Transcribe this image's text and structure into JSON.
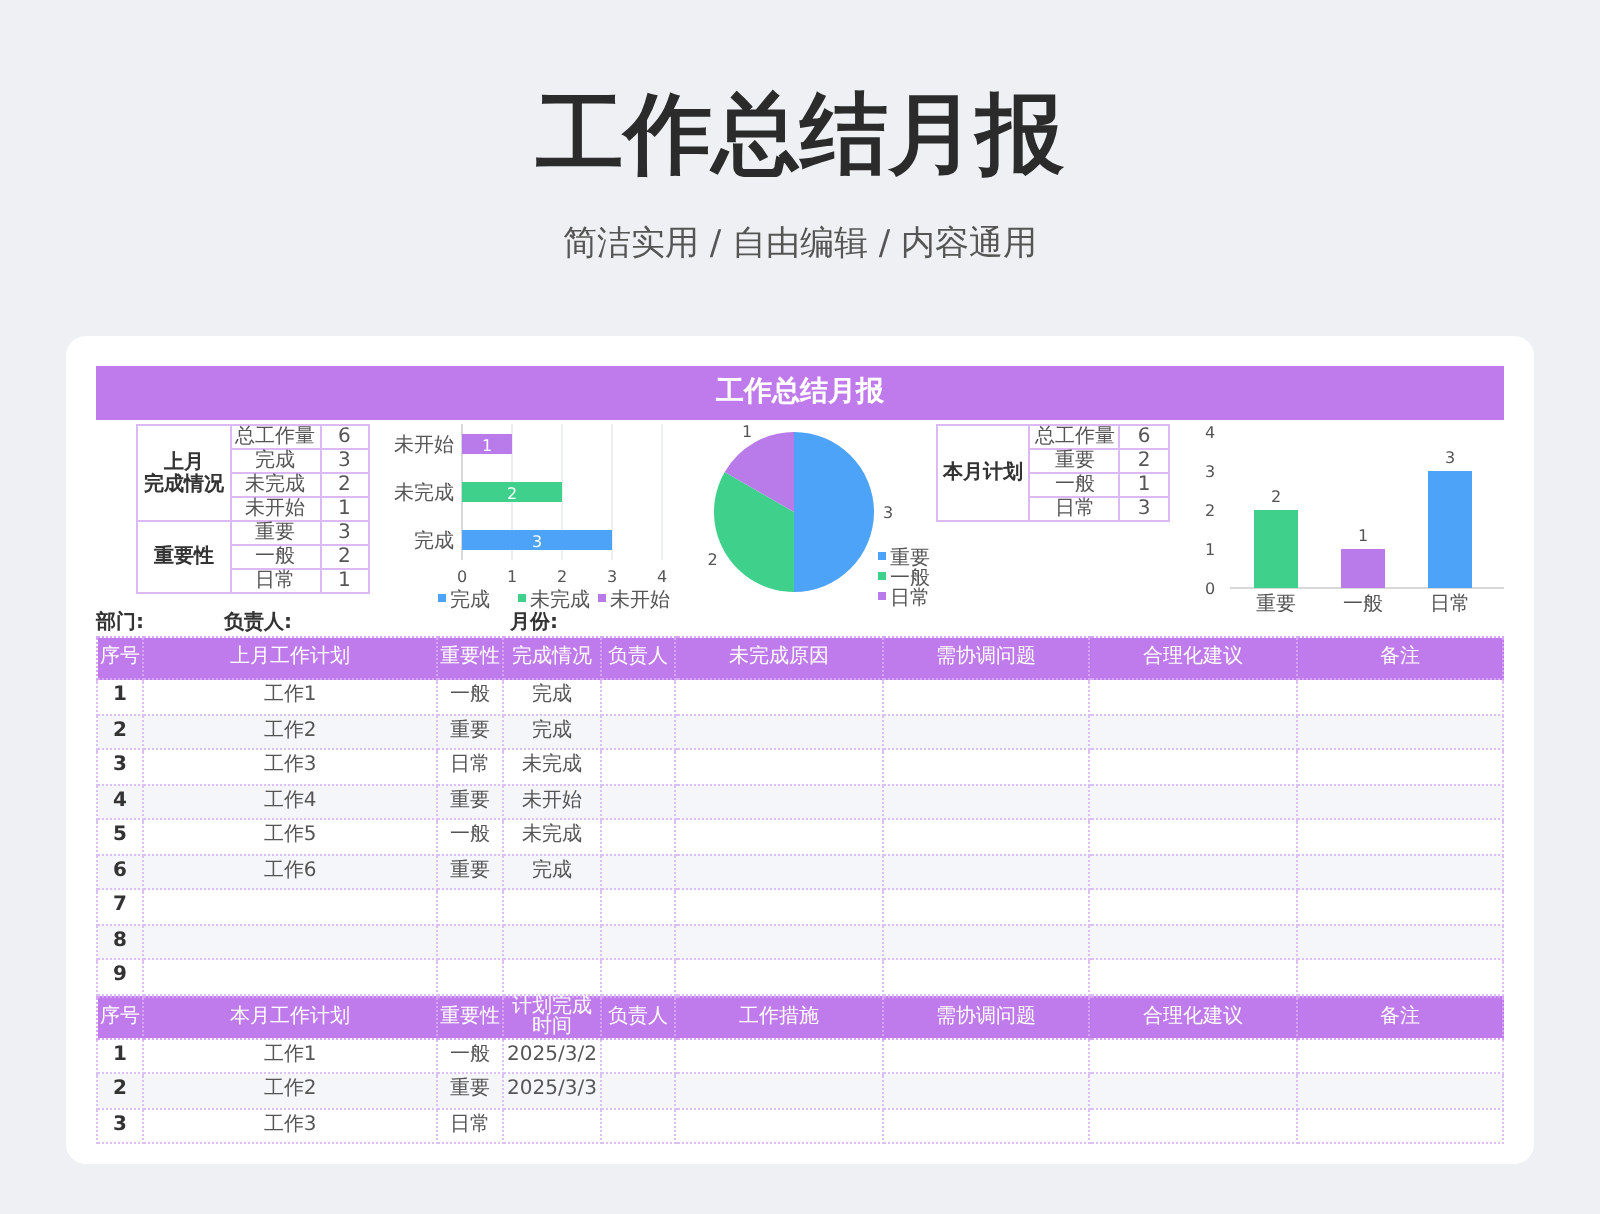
{
  "header": {
    "title": "工作总结月报",
    "subtitle": "简洁实用 / 自由编辑 / 内容通用"
  },
  "sheet": {
    "title": "工作总结月报",
    "last_month_summary": {
      "groups": [
        {
          "label": [
            "上月",
            "完成情况"
          ],
          "items": [
            {
              "name": "总工作量",
              "value": "6"
            },
            {
              "name": "完成",
              "value": "3"
            },
            {
              "name": "未完成",
              "value": "2"
            },
            {
              "name": "未开始",
              "value": "1"
            }
          ]
        },
        {
          "label": [
            "重要性"
          ],
          "items": [
            {
              "name": "重要",
              "value": "3"
            },
            {
              "name": "一般",
              "value": "2"
            },
            {
              "name": "日常",
              "value": "1"
            }
          ]
        }
      ]
    },
    "status_chart": {
      "chart_data": {
        "type": "bar",
        "orientation": "horizontal",
        "categories": [
          "未开始",
          "未完成",
          "完成"
        ],
        "xlim": [
          0,
          4
        ],
        "xticks": [
          0,
          1,
          2,
          3,
          4
        ],
        "grid": true,
        "legend": true,
        "data_labels": true,
        "series": [
          {
            "name": "完成",
            "color": "#4da3f7",
            "values": [
              null,
              null,
              3
            ]
          },
          {
            "name": "未完成",
            "color": "#3fd08c",
            "values": [
              null,
              2,
              null
            ]
          },
          {
            "name": "未开始",
            "color": "#b97aea",
            "values": [
              1,
              null,
              null
            ]
          }
        ]
      }
    },
    "importance_pie": {
      "chart_data": {
        "type": "pie",
        "categories": [
          "重要",
          "一般",
          "日常"
        ],
        "values": [
          3,
          2,
          1
        ],
        "colors": [
          "#4da3f7",
          "#3fd08c",
          "#b97aea"
        ],
        "data_labels": true,
        "legend": true
      }
    },
    "this_month_summary": {
      "groups": [
        {
          "label": [
            "本月计划"
          ],
          "items": [
            {
              "name": "总工作量",
              "value": "6"
            },
            {
              "name": "重要",
              "value": "2"
            },
            {
              "name": "一般",
              "value": "1"
            },
            {
              "name": "日常",
              "value": "3"
            }
          ]
        }
      ]
    },
    "importance_chart": {
      "chart_data": {
        "type": "bar",
        "categories": [
          "重要",
          "一般",
          "日常"
        ],
        "values": [
          2,
          1,
          3
        ],
        "colors": [
          "#3fd08c",
          "#b97aea",
          "#4da3f7"
        ],
        "ylim": [
          0,
          4
        ],
        "yticks": [
          0,
          1,
          2,
          3,
          4
        ],
        "data_labels": true
      }
    },
    "info_fields": [
      "部门:",
      "负责人:",
      "月份:"
    ],
    "last_month_table": {
      "columns": [
        "序号",
        "上月工作计划",
        "重要性",
        "完成情况",
        "负责人",
        "未完成原因",
        "需协调问题",
        "合理化建议",
        "备注"
      ],
      "rows": [
        {
          "cells": [
            "1",
            "工作1",
            "一般",
            "完成"
          ]
        },
        {
          "cells": [
            "2",
            "工作2",
            "重要",
            "完成"
          ]
        },
        {
          "cells": [
            "3",
            "工作3",
            "日常",
            "未完成"
          ]
        },
        {
          "cells": [
            "4",
            "工作4",
            "重要",
            "未开始"
          ]
        },
        {
          "cells": [
            "5",
            "工作5",
            "一般",
            "未完成"
          ]
        },
        {
          "cells": [
            "6",
            "工作6",
            "重要",
            "完成"
          ]
        },
        {
          "cells": [
            "7"
          ]
        },
        {
          "cells": [
            "8"
          ]
        },
        {
          "cells": [
            "9"
          ]
        }
      ]
    },
    "this_month_table": {
      "columns": [
        "序号",
        "本月工作计划",
        "重要性",
        "计划完成时间",
        "负责人",
        "工作措施",
        "需协调问题",
        "合理化建议",
        "备注"
      ],
      "rows": [
        {
          "cells": [
            "1",
            "工作1",
            "一般",
            "2025/3/2"
          ]
        },
        {
          "cells": [
            "2",
            "工作2",
            "重要",
            "2025/3/3"
          ]
        },
        {
          "cells": [
            "3",
            "工作3",
            "日常"
          ]
        }
      ]
    }
  }
}
